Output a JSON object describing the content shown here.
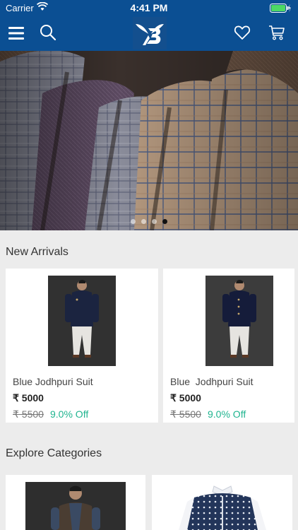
{
  "status_bar": {
    "carrier": "Carrier",
    "time": "4:41 PM"
  },
  "nav": {
    "icons": [
      "menu-icon",
      "search-icon",
      "brand-logo",
      "heart-icon",
      "cart-icon"
    ],
    "brand_color": "#0b4f93"
  },
  "hero": {
    "slide_count": 4,
    "active_slide": 4
  },
  "new_arrivals": {
    "title": "New Arrivals",
    "products": [
      {
        "name": "Blue Jodhpuri Suit",
        "price": "₹ 5000",
        "mrp": "₹ 5500",
        "discount": "9.0% Off"
      },
      {
        "name": "Blue  Jodhpuri Suit",
        "price": "₹ 5000",
        "mrp": "₹ 5500",
        "discount": "9.0% Off"
      }
    ]
  },
  "categories": {
    "title": "Explore Categories"
  },
  "colors": {
    "accent": "#0b4f93",
    "discount": "#1fb48f"
  }
}
